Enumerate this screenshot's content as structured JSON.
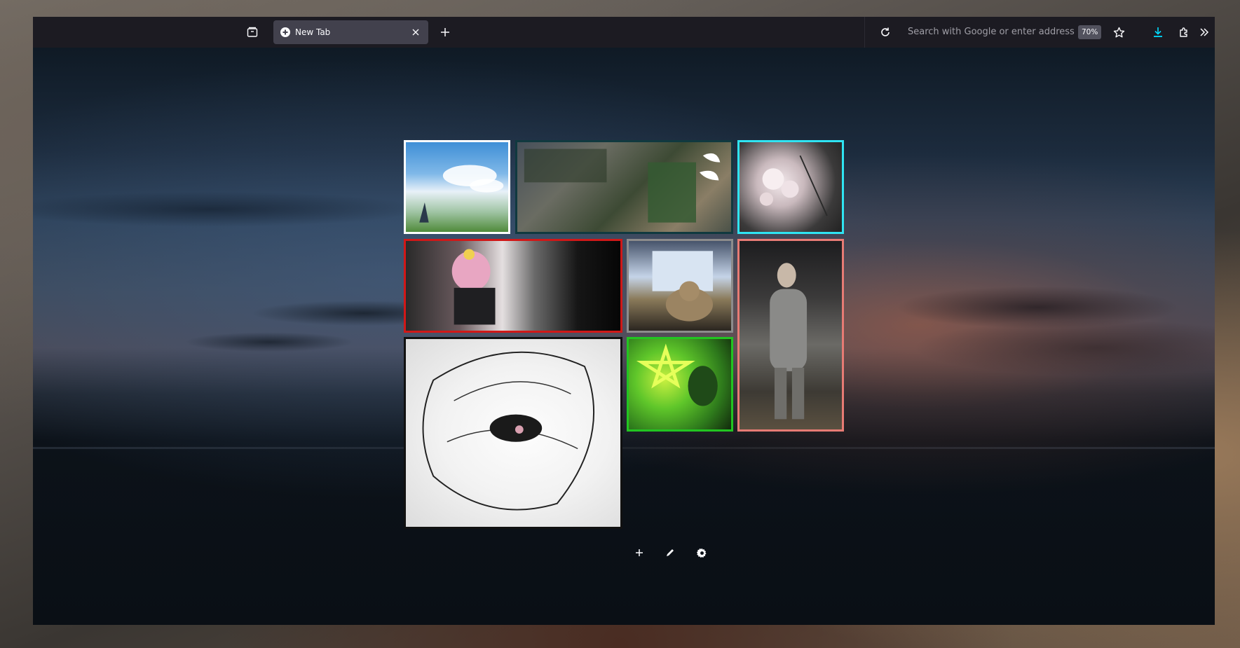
{
  "browser": {
    "tab": {
      "title": "New Tab",
      "favicon": "plus-circle-icon"
    },
    "urlbar": {
      "placeholder": "Search with Google or enter address",
      "zoom": "70%"
    },
    "toolbar_icons": [
      "tab-overview-icon",
      "close-icon",
      "plus-icon",
      "reload-icon",
      "star-icon",
      "download-icon",
      "extensions-icon",
      "chevron-double-right-icon"
    ],
    "accent_color": "#00ddff"
  },
  "newtab": {
    "tiles": [
      {
        "name": "anime-sky-field",
        "border_color": "#ffffff"
      },
      {
        "name": "anime-cluttered-room",
        "border_color": "#10393f"
      },
      {
        "name": "cherry-blossom",
        "border_color": "#2fe4f2"
      },
      {
        "name": "anime-girl-guitar",
        "border_color": "#d01818"
      },
      {
        "name": "cat-on-laptop",
        "border_color": "#8c8c8c"
      },
      {
        "name": "armored-knight",
        "border_color": "#e77b74"
      },
      {
        "name": "hooded-figure-sketch",
        "border_color": "#111111"
      },
      {
        "name": "green-pentagram",
        "border_color": "#22c521"
      }
    ],
    "controls": [
      "plus-icon",
      "pencil-icon",
      "gear-icon"
    ]
  }
}
